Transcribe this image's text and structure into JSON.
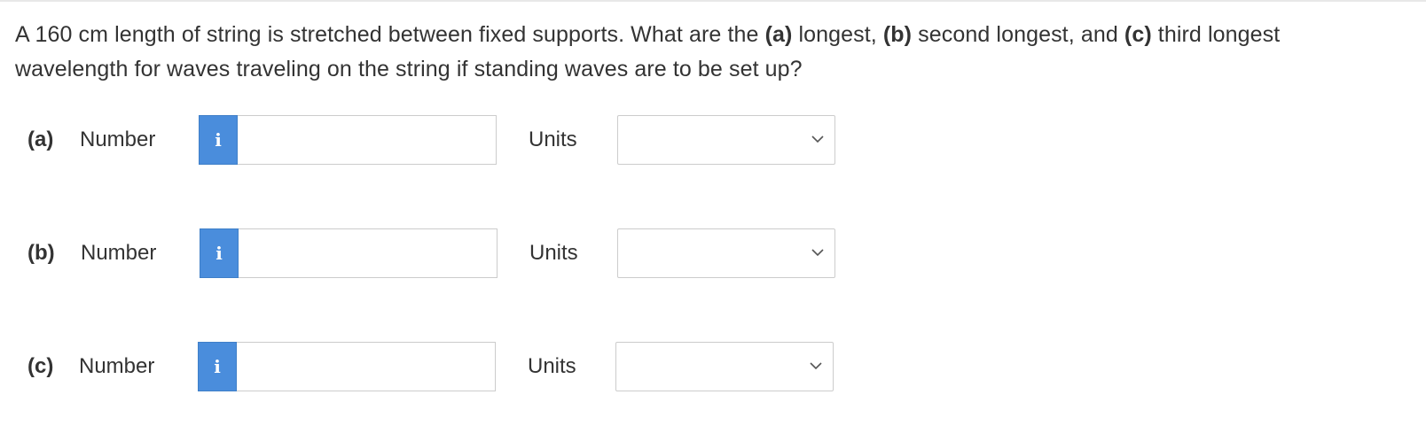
{
  "question": {
    "segments": [
      {
        "text": "A 160 cm length of string is stretched between fixed supports. What are the ",
        "bold": false
      },
      {
        "text": "(a)",
        "bold": true
      },
      {
        "text": " longest, ",
        "bold": false
      },
      {
        "text": "(b)",
        "bold": true
      },
      {
        "text": " second longest, and ",
        "bold": false
      },
      {
        "text": "(c)",
        "bold": true
      },
      {
        "text": " third longest wavelength for waves traveling on the string if standing waves are to be set up?",
        "bold": false
      }
    ]
  },
  "parts": [
    {
      "label": "(a)",
      "number_label": "Number",
      "info_icon": "info-icon",
      "info_glyph": "i",
      "number_value": "",
      "units_label": "Units",
      "units_value": ""
    },
    {
      "label": "(b)",
      "number_label": "Number",
      "info_icon": "info-icon",
      "info_glyph": "i",
      "number_value": "",
      "units_label": "Units",
      "units_value": ""
    },
    {
      "label": "(c)",
      "number_label": "Number",
      "info_icon": "info-icon",
      "info_glyph": "i",
      "number_value": "",
      "units_label": "Units",
      "units_value": ""
    }
  ],
  "colors": {
    "info_button": "#4a8ddc",
    "text": "#333333",
    "border": "#cccccc"
  }
}
